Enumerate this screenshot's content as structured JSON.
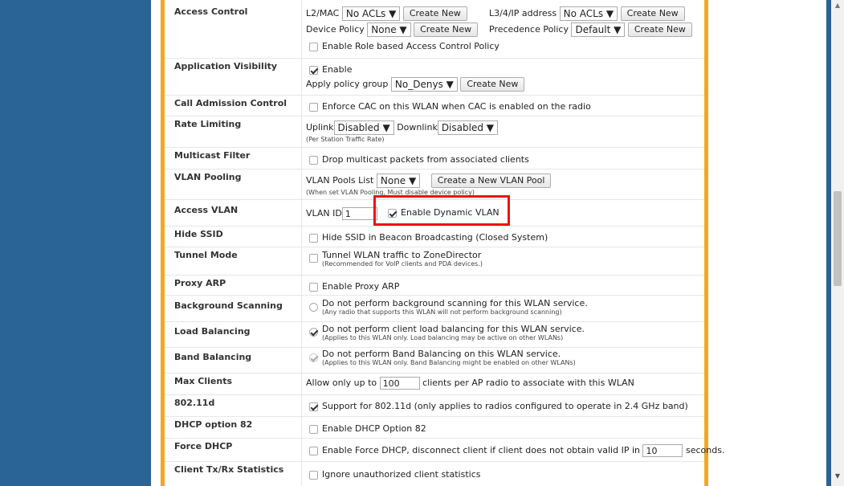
{
  "rows": {
    "access_control": {
      "label": "Access Control",
      "l2mac_label": "L2/MAC",
      "l2mac_select": "No ACLs ▼",
      "l3_label": "L3/4/IP address",
      "l3_select": "No ACLs ▼",
      "device_policy_label": "Device Policy",
      "device_policy_select": "None ▼",
      "precedence_label": "Precedence Policy",
      "precedence_select": "Default ▼",
      "create_new": "Create New",
      "role_based": "Enable Role based Access Control Policy"
    },
    "app_visibility": {
      "label": "Application Visibility",
      "enable": "Enable",
      "apply_label": "Apply policy group",
      "policy_select": "No_Denys ▼",
      "create_new": "Create New"
    },
    "cac": {
      "label": "Call Admission Control",
      "text": "Enforce CAC on this WLAN when CAC is enabled on the radio"
    },
    "rate_limiting": {
      "label": "Rate Limiting",
      "uplink": "Uplink",
      "uplink_select": "Disabled     ▼",
      "downlink": "Downlink",
      "downlink_select": "Disabled     ▼",
      "note": "(Per Station Traffic Rate)"
    },
    "multicast": {
      "label": "Multicast Filter",
      "text": "Drop multicast packets from associated clients"
    },
    "vlan_pooling": {
      "label": "VLAN Pooling",
      "list_label": "VLAN Pools List",
      "select": "None ▼",
      "button": "Create a New VLAN Pool",
      "note": "(When set VLAN Pooling, Must disable device policy)"
    },
    "access_vlan": {
      "label": "Access VLAN",
      "vlan_id_label": "VLAN ID",
      "vlan_id_value": "1",
      "dynamic": "Enable Dynamic VLAN"
    },
    "hide_ssid": {
      "label": "Hide SSID",
      "text": "Hide SSID in Beacon Broadcasting (Closed System)"
    },
    "tunnel": {
      "label": "Tunnel Mode",
      "text": "Tunnel WLAN traffic to ZoneDirector",
      "note": "(Recommended for VoIP clients and PDA devices.)"
    },
    "proxy_arp": {
      "label": "Proxy ARP",
      "text": "Enable Proxy ARP"
    },
    "bg_scanning": {
      "label": "Background Scanning",
      "text": "Do not perform background scanning for this WLAN service.",
      "note": "(Any radio that supports this WLAN will not perform background scanning)"
    },
    "load_balancing": {
      "label": "Load Balancing",
      "text": "Do not perform client load balancing for this WLAN service.",
      "note": "(Applies to this WLAN only. Load balancing may be active on other WLANs)"
    },
    "band_balancing": {
      "label": "Band Balancing",
      "text": "Do not perform Band Balancing on this WLAN service.",
      "note": "(Applies to this WLAN only. Band Balancing might be enabled on other WLANs)"
    },
    "max_clients": {
      "label": "Max Clients",
      "prefix": "Allow only up to",
      "value": "100",
      "suffix": "clients per AP radio to associate with this WLAN"
    },
    "dot11d": {
      "label": "802.11d",
      "text": "Support for 802.11d (only applies to radios configured to operate in 2.4 GHz band)"
    },
    "dhcp82": {
      "label": "DHCP option 82",
      "text": "Enable DHCP Option 82"
    },
    "force_dhcp": {
      "label": "Force DHCP",
      "text": "Enable Force DHCP, disconnect client if client does not obtain valid IP in",
      "value": "10",
      "suffix": "seconds."
    },
    "client_stats": {
      "label": "Client Tx/Rx Statistics",
      "text": "Ignore unauthorized client statistics"
    }
  },
  "colors": {
    "sidebar": "#2a6496",
    "frame": "#f5a623",
    "highlight": "#e11111"
  }
}
